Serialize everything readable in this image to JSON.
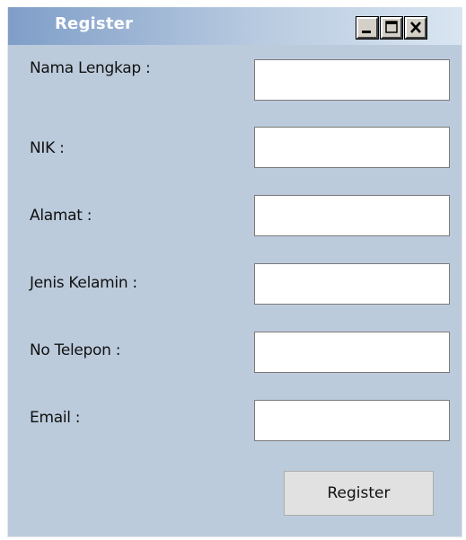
{
  "window": {
    "title": "Register",
    "controls": {
      "minimize": "minimize-icon",
      "maximize": "maximize-icon",
      "close": "close-icon"
    }
  },
  "form": {
    "fields": [
      {
        "label": "Nama Lengkap :",
        "value": "",
        "placeholder": ""
      },
      {
        "label": "NIK :",
        "value": "",
        "placeholder": ""
      },
      {
        "label": "Alamat :",
        "value": "",
        "placeholder": ""
      },
      {
        "label": "Jenis Kelamin :",
        "value": "",
        "placeholder": ""
      },
      {
        "label": "No Telepon :",
        "value": "",
        "placeholder": ""
      },
      {
        "label": "Email :",
        "value": "",
        "placeholder": ""
      }
    ],
    "submit_label": "Register"
  },
  "colors": {
    "window_background": "#bccbdc",
    "titlebar_start": "#7f9ec8",
    "titlebar_end": "#d9e5f1",
    "title_text": "#ffffff",
    "button_face": "#e1e1e1"
  }
}
